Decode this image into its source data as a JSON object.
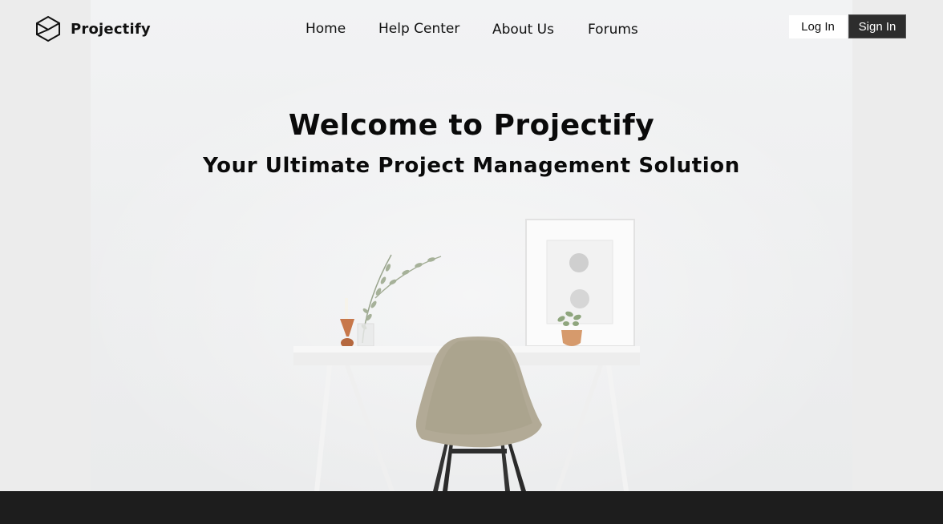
{
  "brand": {
    "name": "Projectify",
    "icon": "hexagon-box-icon"
  },
  "nav": {
    "items": [
      {
        "label": "Home"
      },
      {
        "label": "Help Center"
      },
      {
        "label": "About Us"
      },
      {
        "label": "Forums"
      }
    ]
  },
  "auth": {
    "login_label": "Log In",
    "signin_label": "Sign In"
  },
  "hero": {
    "title": "Welcome to Projectify",
    "subtitle": "Your Ultimate Project Management Solution"
  },
  "colors": {
    "signin_bg": "#2d2d2d",
    "footer_bg": "#1d1d1d",
    "hero_bg": "#ececec"
  }
}
